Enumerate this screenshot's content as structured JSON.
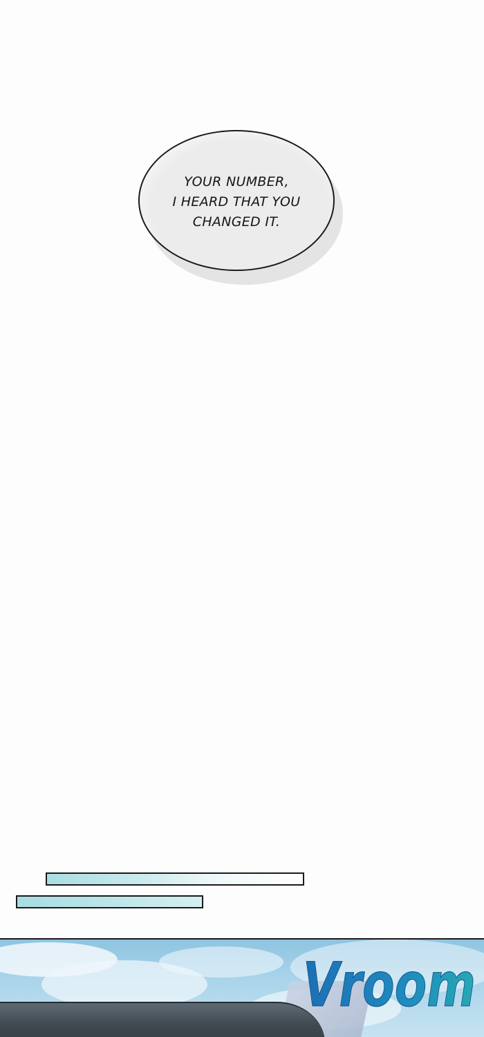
{
  "speech_bubble": {
    "lines": [
      "YOUR NUMBER,",
      "I HEARD THAT YOU",
      "CHANGED IT."
    ]
  },
  "sound_effect": {
    "text": "Vroom",
    "color": "#1f7ab8"
  }
}
